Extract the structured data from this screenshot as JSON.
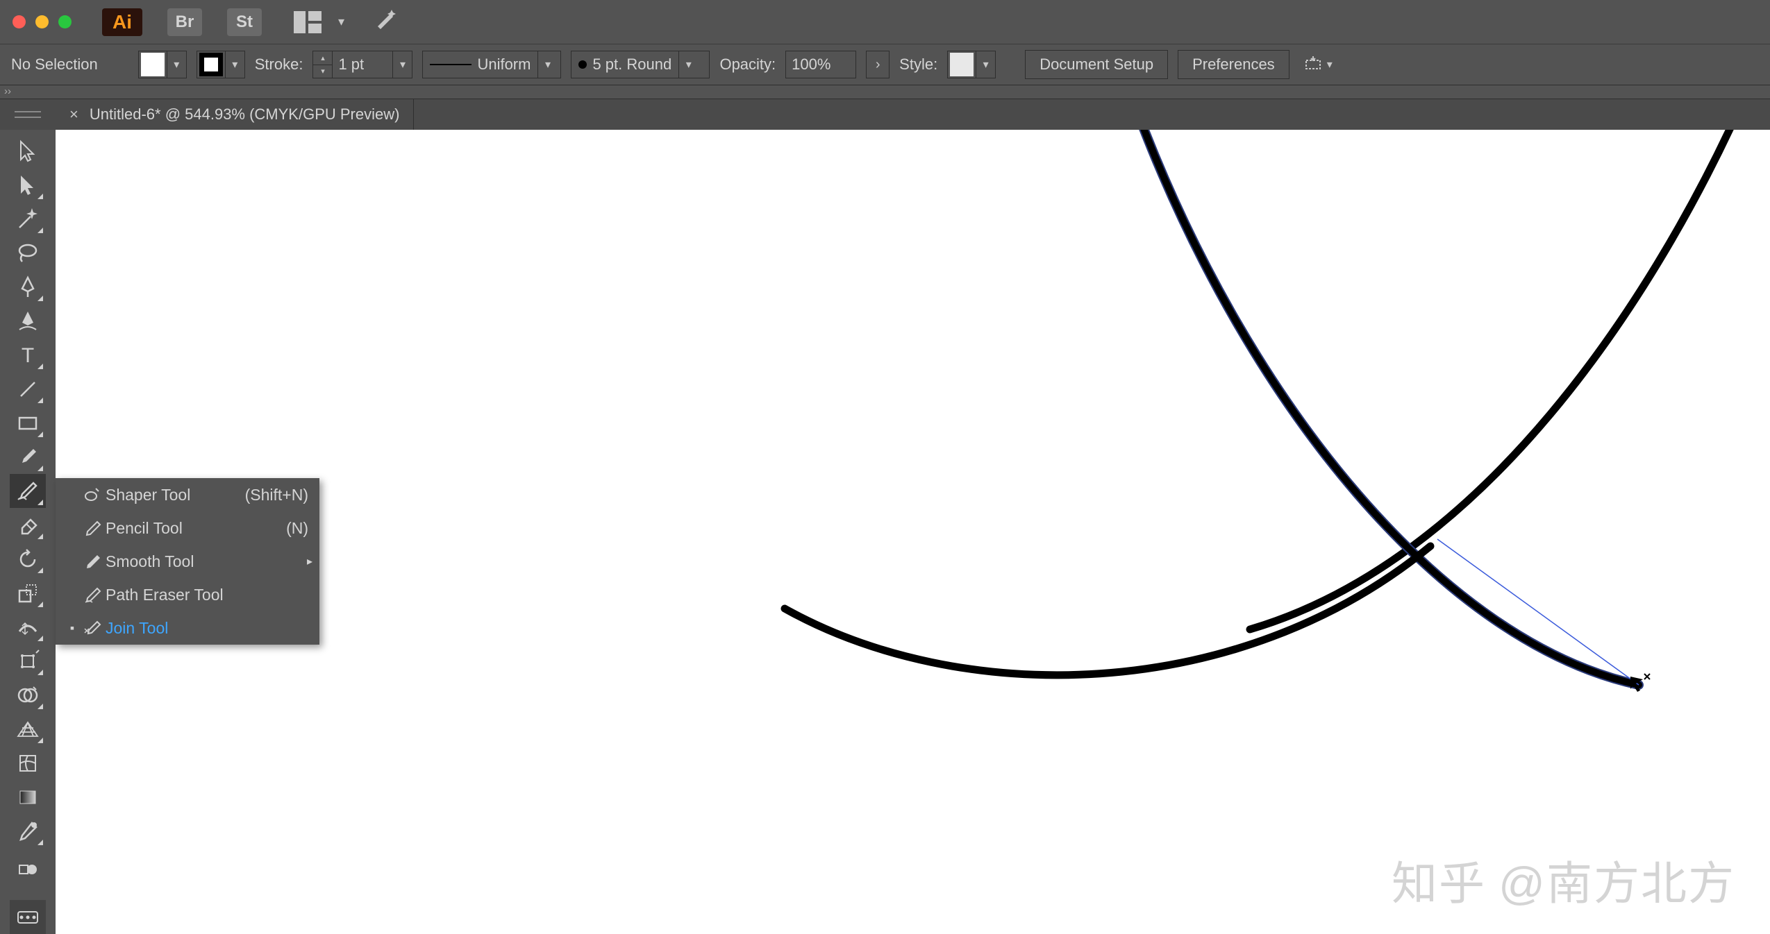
{
  "app": {
    "ai_label": "Ai",
    "br_label": "Br",
    "st_label": "St"
  },
  "optbar": {
    "selection_state": "No Selection",
    "stroke_label": "Stroke:",
    "stroke_value": "1 pt",
    "profile_label": "Uniform",
    "brush_label": "5 pt. Round",
    "opacity_label": "Opacity:",
    "opacity_value": "100%",
    "style_label": "Style:",
    "doc_setup": "Document Setup",
    "preferences": "Preferences"
  },
  "tab": {
    "title": "Untitled-6* @ 544.93% (CMYK/GPU Preview)"
  },
  "flyout": {
    "items": [
      {
        "label": "Shaper Tool",
        "shortcut": "(Shift+N)",
        "selected": false,
        "submenu": false
      },
      {
        "label": "Pencil Tool",
        "shortcut": "(N)",
        "selected": false,
        "submenu": false
      },
      {
        "label": "Smooth Tool",
        "shortcut": "",
        "selected": false,
        "submenu": true
      },
      {
        "label": "Path Eraser Tool",
        "shortcut": "",
        "selected": false,
        "submenu": false
      },
      {
        "label": "Join Tool",
        "shortcut": "",
        "selected": true,
        "submenu": false
      }
    ]
  },
  "watermark": {
    "site": "知乎",
    "at": "@南方北方"
  }
}
